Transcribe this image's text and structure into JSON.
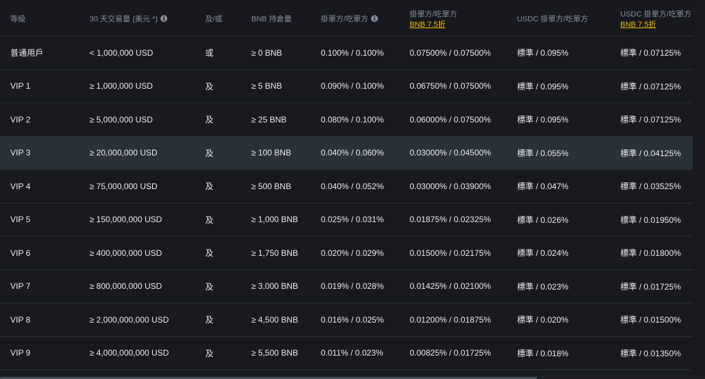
{
  "headers": {
    "tier": "等級",
    "volume": "30 天交易量 (美元 *)",
    "andor": "及/或",
    "bnb": "BNB 持倉量",
    "maker_taker": "掛單方/吃單方",
    "maker_taker_bnb": "掛單方/吃單方",
    "maker_taker_bnb_promo": "BNB 7.5折",
    "usdc": "USDC 掛單方/吃單方",
    "usdc_bnb": "USDC 掛單方/吃單方",
    "usdc_bnb_promo": "BNB 7.5折",
    "info_icon": "i"
  },
  "rows": [
    {
      "tier": "普通用戶",
      "volume": "< 1,000,000 USD",
      "andor": "或",
      "bnb": "≥ 0 BNB",
      "fee": "0.100% / 0.100%",
      "fee_bnb": "0.07500% / 0.07500%",
      "usdc": "標準 / 0.095%",
      "usdc_bnb": "標準 / 0.07125%"
    },
    {
      "tier": "VIP 1",
      "volume": "≥ 1,000,000 USD",
      "andor": "及",
      "bnb": "≥ 5 BNB",
      "fee": "0.090% / 0.100%",
      "fee_bnb": "0.06750% / 0.07500%",
      "usdc": "標準 / 0.095%",
      "usdc_bnb": "標準 / 0.07125%"
    },
    {
      "tier": "VIP 2",
      "volume": "≥ 5,000,000 USD",
      "andor": "及",
      "bnb": "≥ 25 BNB",
      "fee": "0.080% / 0.100%",
      "fee_bnb": "0.06000% / 0.07500%",
      "usdc": "標準 / 0.095%",
      "usdc_bnb": "標準 / 0.07125%"
    },
    {
      "tier": "VIP 3",
      "volume": "≥ 20,000,000 USD",
      "andor": "及",
      "bnb": "≥ 100 BNB",
      "fee": "0.040% / 0.060%",
      "fee_bnb": "0.03000% / 0.04500%",
      "usdc": "標準 / 0.055%",
      "usdc_bnb": "標準 / 0.04125%"
    },
    {
      "tier": "VIP 4",
      "volume": "≥ 75,000,000 USD",
      "andor": "及",
      "bnb": "≥ 500 BNB",
      "fee": "0.040% / 0.052%",
      "fee_bnb": "0.03000% / 0.03900%",
      "usdc": "標準 / 0.047%",
      "usdc_bnb": "標準 / 0.03525%"
    },
    {
      "tier": "VIP 5",
      "volume": "≥ 150,000,000 USD",
      "andor": "及",
      "bnb": "≥ 1,000 BNB",
      "fee": "0.025% / 0.031%",
      "fee_bnb": "0.01875% / 0.02325%",
      "usdc": "標準 / 0.026%",
      "usdc_bnb": "標準 / 0.01950%"
    },
    {
      "tier": "VIP 6",
      "volume": "≥ 400,000,000 USD",
      "andor": "及",
      "bnb": "≥ 1,750 BNB",
      "fee": "0.020% / 0.029%",
      "fee_bnb": "0.01500% / 0.02175%",
      "usdc": "標準 / 0.024%",
      "usdc_bnb": "標準 / 0.01800%"
    },
    {
      "tier": "VIP 7",
      "volume": "≥ 800,000,000 USD",
      "andor": "及",
      "bnb": "≥ 3,000 BNB",
      "fee": "0.019% / 0.028%",
      "fee_bnb": "0.01425% / 0.02100%",
      "usdc": "標準 / 0.023%",
      "usdc_bnb": "標準 / 0.01725%"
    },
    {
      "tier": "VIP 8",
      "volume": "≥ 2,000,000,000 USD",
      "andor": "及",
      "bnb": "≥ 4,500 BNB",
      "fee": "0.016% / 0.025%",
      "fee_bnb": "0.01200% / 0.01875%",
      "usdc": "標準 / 0.020%",
      "usdc_bnb": "標準 / 0.01500%"
    },
    {
      "tier": "VIP 9",
      "volume": "≥ 4,000,000,000 USD",
      "andor": "及",
      "bnb": "≥ 5,500 BNB",
      "fee": "0.011% / 0.023%",
      "fee_bnb": "0.00825% / 0.01725%",
      "usdc": "標準 / 0.018%",
      "usdc_bnb": "標準 / 0.01350%"
    }
  ],
  "highlighted_row": 3,
  "colors": {
    "background": "#181a20",
    "highlight": "#2b3139",
    "muted": "#848e9c",
    "accent": "#f0b90b",
    "text": "#eaecef"
  }
}
